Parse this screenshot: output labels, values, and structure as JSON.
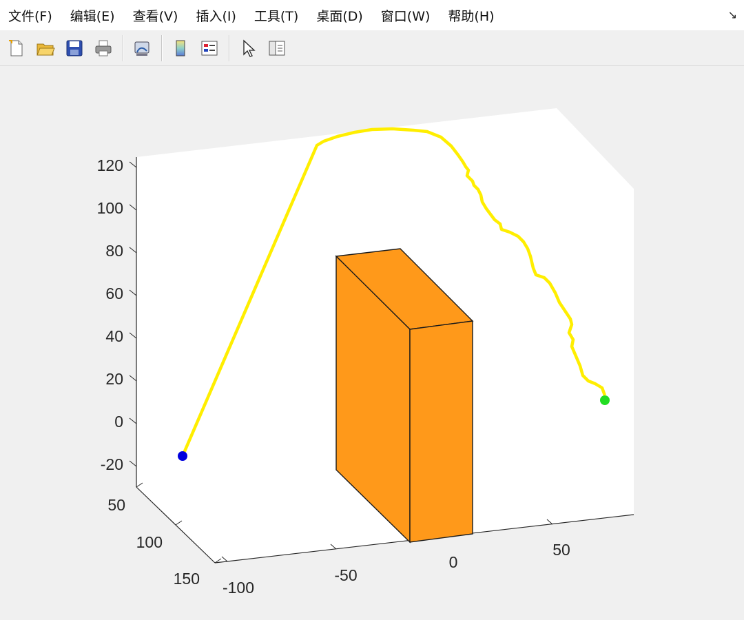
{
  "menu": {
    "items": [
      {
        "label": "文件(F)",
        "name": "menu-file"
      },
      {
        "label": "编辑(E)",
        "name": "menu-edit"
      },
      {
        "label": "查看(V)",
        "name": "menu-view"
      },
      {
        "label": "插入(I)",
        "name": "menu-insert"
      },
      {
        "label": "工具(T)",
        "name": "menu-tools"
      },
      {
        "label": "桌面(D)",
        "name": "menu-desktop"
      },
      {
        "label": "窗口(W)",
        "name": "menu-window"
      },
      {
        "label": "帮助(H)",
        "name": "menu-help"
      }
    ],
    "dock_glyph": "↘"
  },
  "toolbar": {
    "icons": [
      "new-file-icon",
      "open-folder-icon",
      "save-icon",
      "print-icon",
      "link-figure-icon",
      "colorbar-icon",
      "legend-icon",
      "pointer-icon",
      "property-editor-icon"
    ]
  },
  "colors": {
    "path": "#ffee00",
    "obstacle": "#ff991a",
    "start_marker": "#0000dd",
    "goal_marker": "#22dd22"
  },
  "chart_data": {
    "type": "line3d",
    "z_ticks": [
      "120",
      "100",
      "80",
      "60",
      "40",
      "20",
      "0",
      "-20"
    ],
    "y_ticks": [
      "50",
      "100",
      "150"
    ],
    "x_ticks": [
      "-100",
      "-50",
      "0",
      "50"
    ],
    "grid": false
  }
}
